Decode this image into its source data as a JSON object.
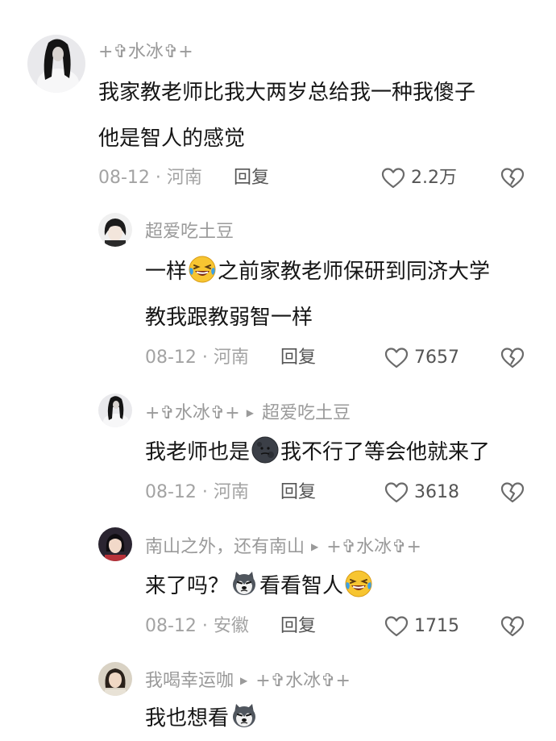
{
  "comments": [
    {
      "user": "+✞水冰✞+",
      "text_lines": [
        "我家教老师比我大两岁总给我一种我傻子",
        "他是智人的感觉"
      ],
      "date_loc": "08-12 · 河南",
      "reply_label": "回复",
      "likes": "2.2万"
    },
    {
      "user": "超爱吃土豆",
      "text_a": "一样",
      "emoji_1": "laughing-crying-emoji",
      "text_b": "之前家教老师保研到同济大学",
      "text_line2": "教我跟教弱智一样",
      "date_loc": "08-12 · 河南",
      "reply_label": "回复",
      "likes": "7657"
    },
    {
      "user": "+✞水冰✞+",
      "reply_to": "超爱吃土豆",
      "text_a": "我老师也是",
      "emoji_1": "dark-moon-emoji",
      "text_b": "我不行了等会他就来了",
      "date_loc": "08-12 · 河南",
      "reply_label": "回复",
      "likes": "3618"
    },
    {
      "user": "南山之外，还有南山",
      "reply_to": "+✞水冰✞+",
      "text_a": "来了吗？",
      "emoji_1": "husky-dog-emoji",
      "text_b": "看看智人",
      "emoji_2": "laughing-crying-emoji",
      "date_loc": "08-12 · 安徽",
      "reply_label": "回复",
      "likes": "1715"
    },
    {
      "user": "我喝幸运咖",
      "reply_to": "+✞水冰✞+",
      "text_a": "我也想看",
      "emoji_1": "husky-dog-emoji"
    }
  ]
}
